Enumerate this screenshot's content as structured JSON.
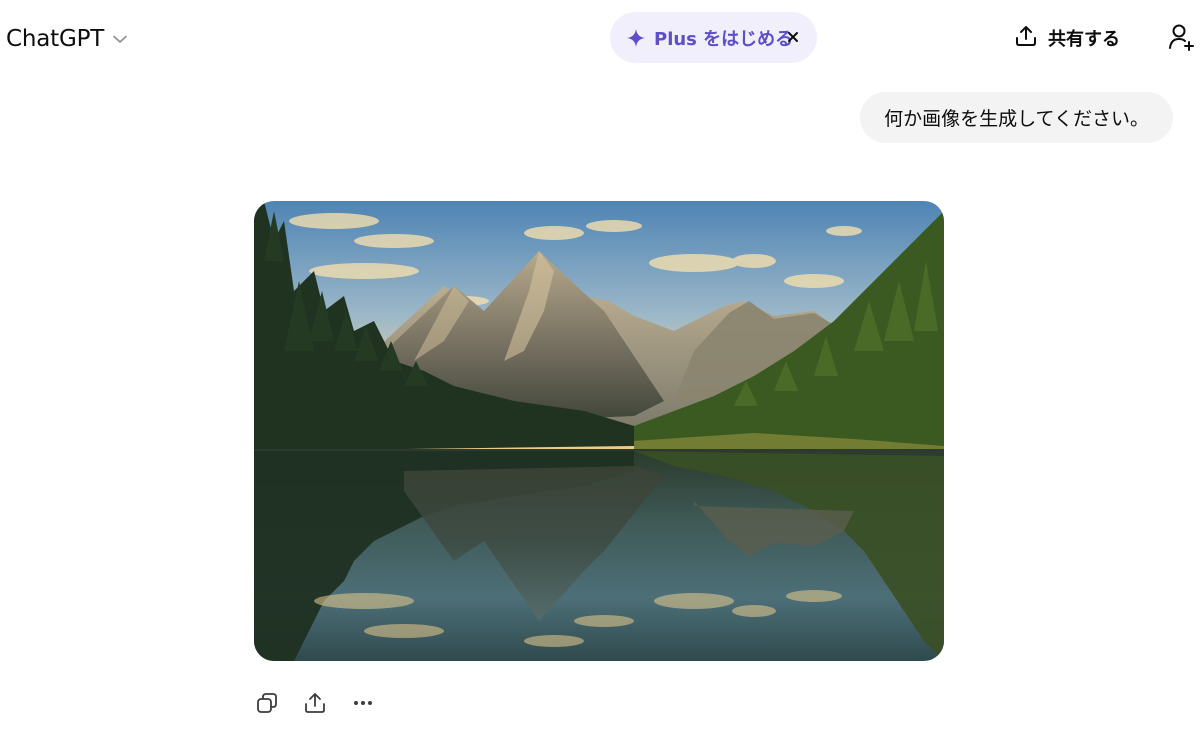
{
  "header": {
    "model_name": "ChatGPT",
    "model_chevron_icon": "chevron-down-icon",
    "plus_pill": {
      "label": "Plus をはじめる",
      "icon": "sparkle-icon",
      "close_icon": "close-icon",
      "accent_color": "#5d4ecb",
      "background": "#f1effc"
    },
    "share": {
      "label": "共有する",
      "icon": "share-upload-icon"
    },
    "add_user_icon": "add-user-icon"
  },
  "conversation": {
    "user_message": "何か画像を生成してください。",
    "assistant_image": {
      "subject": "mountain-lake-reflection"
    },
    "actions": [
      {
        "name": "copy-icon"
      },
      {
        "name": "share-icon"
      },
      {
        "name": "more-icon"
      }
    ]
  }
}
